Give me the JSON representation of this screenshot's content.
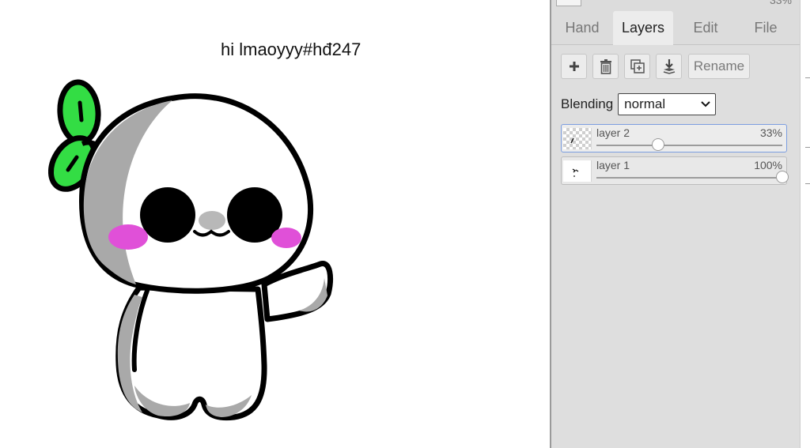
{
  "canvas": {
    "text": "hi lmaoyyy#hđ247",
    "drawing": {
      "subject": "white cartoon character with green sprout, black eyes and pink cheeks, waving",
      "colors": {
        "outline": "#000000",
        "body": "#ffffff",
        "shade": "#a9a9a9",
        "sprout": "#33dd44",
        "cheeks": "#e050d8",
        "nose": "#b8b8b8"
      }
    }
  },
  "panel": {
    "top_opacity": "33%",
    "tabs": [
      {
        "label": "Hand",
        "active": false
      },
      {
        "label": "Layers",
        "active": true
      },
      {
        "label": "Edit",
        "active": false
      },
      {
        "label": "File",
        "active": false
      }
    ],
    "toolbar": {
      "add_icon": "plus-icon",
      "delete_icon": "trash-icon",
      "duplicate_icon": "duplicate-icon",
      "merge_icon": "merge-down-icon",
      "rename_label": "Rename"
    },
    "blending": {
      "label": "Blending",
      "value": "normal"
    },
    "layers": [
      {
        "name": "layer 2",
        "opacity": "33%",
        "opacity_value": 0.33,
        "selected": true
      },
      {
        "name": "layer 1",
        "opacity": "100%",
        "opacity_value": 1.0,
        "selected": false
      }
    ],
    "colors": {
      "panel_bg": "#dcdcdc",
      "tab_active_bg": "#ececec",
      "selected_border": "#7c9ee0"
    }
  }
}
